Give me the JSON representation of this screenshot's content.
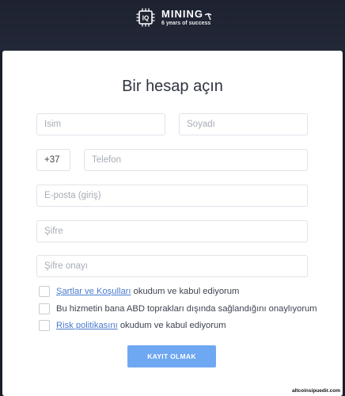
{
  "brand": {
    "logo_mark": "IQ",
    "name": "MINING",
    "tagline": "6 years of success"
  },
  "form": {
    "title": "Bir hesap açın",
    "first_name_placeholder": "İsim",
    "last_name_placeholder": "Soyadı",
    "country_code": "+37",
    "phone_placeholder": "Telefon",
    "email_placeholder": "E-posta (giriş)",
    "password_placeholder": "Şifre",
    "password_confirm_placeholder": "Şifre onayı",
    "terms_link": "Şartlar ve Koşulları",
    "terms_text": " okudum ve kabul ediyorum",
    "us_text": "Bu hizmetin bana ABD toprakları dışında sağlandığını onaylıyorum",
    "risk_link": "Risk politikasını",
    "risk_text": " okudum ve kabul ediyorum",
    "submit_label": "KAYIT OLMAK"
  },
  "watermark": "altcoinsipuedir.com",
  "colors": {
    "header_bg": "#1d2230",
    "button": "#6fa8f2",
    "link": "#4a7bd0"
  }
}
